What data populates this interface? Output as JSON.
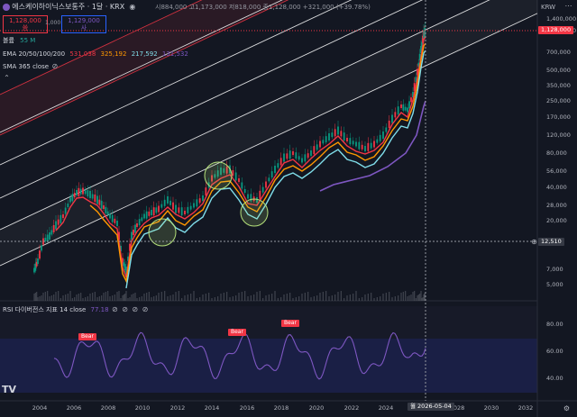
{
  "header": {
    "symbol_title": "에스케이하이닉스보통주 · 1달 · KRX",
    "ohlc_text": "시884,000  고1,173,000  저818,000  종1,128,000  +321,000 (+39.78%)",
    "price_box_sell": "1,128,000",
    "price_box_sell_sub": "씀",
    "price_box_buy": "1,129,000",
    "price_box_buy_sub": "사",
    "spread": "1,000",
    "volume_label": "볼륨",
    "volume_value": "55 M",
    "ema_label": "EMA 20/50/100/200",
    "ema_values": [
      "531,038",
      "325,192",
      "217,592",
      "131,532"
    ],
    "sma_label": "SMA 365 close",
    "rsi_label": "RSI 다이버전스 지표 14 close",
    "rsi_value": "77.18",
    "currency": "KRW"
  },
  "price_axis": {
    "labels": [
      "1,400,000",
      "1,000,000",
      "700,000",
      "500,000",
      "350,000",
      "250,000",
      "170,000",
      "120,000",
      "80,000",
      "56,000",
      "40,000",
      "28,000",
      "20,000",
      "12,510",
      "7,000",
      "5,000"
    ],
    "current_price": "1,128,000",
    "crosshair_price": "12,510"
  },
  "rsi_axis": {
    "labels": [
      "80.00",
      "60.00",
      "40.00"
    ]
  },
  "time_axis": {
    "labels": [
      "2004",
      "2006",
      "2008",
      "2010",
      "2012",
      "2014",
      "2016",
      "2018",
      "2020",
      "2022",
      "2024",
      "2028",
      "2030",
      "2032"
    ],
    "crosshair_date": "월 2026-05-04"
  },
  "annotations": {
    "bear_label": "Bear"
  },
  "colors": {
    "background": "#131722",
    "bull": "#089981",
    "bear": "#f23645",
    "ema20": "#f23645",
    "ema50": "#ff9800",
    "ema100": "#80deea",
    "ema200": "#7e57c2",
    "rsi": "#7e57c2",
    "channel": "#ffffff",
    "circle": "#b4e07a"
  },
  "logo": "TV",
  "icons": [
    "eye-icon",
    "settings-icon",
    "close-icon",
    "more-icon",
    "fullscreen-icon"
  ]
}
